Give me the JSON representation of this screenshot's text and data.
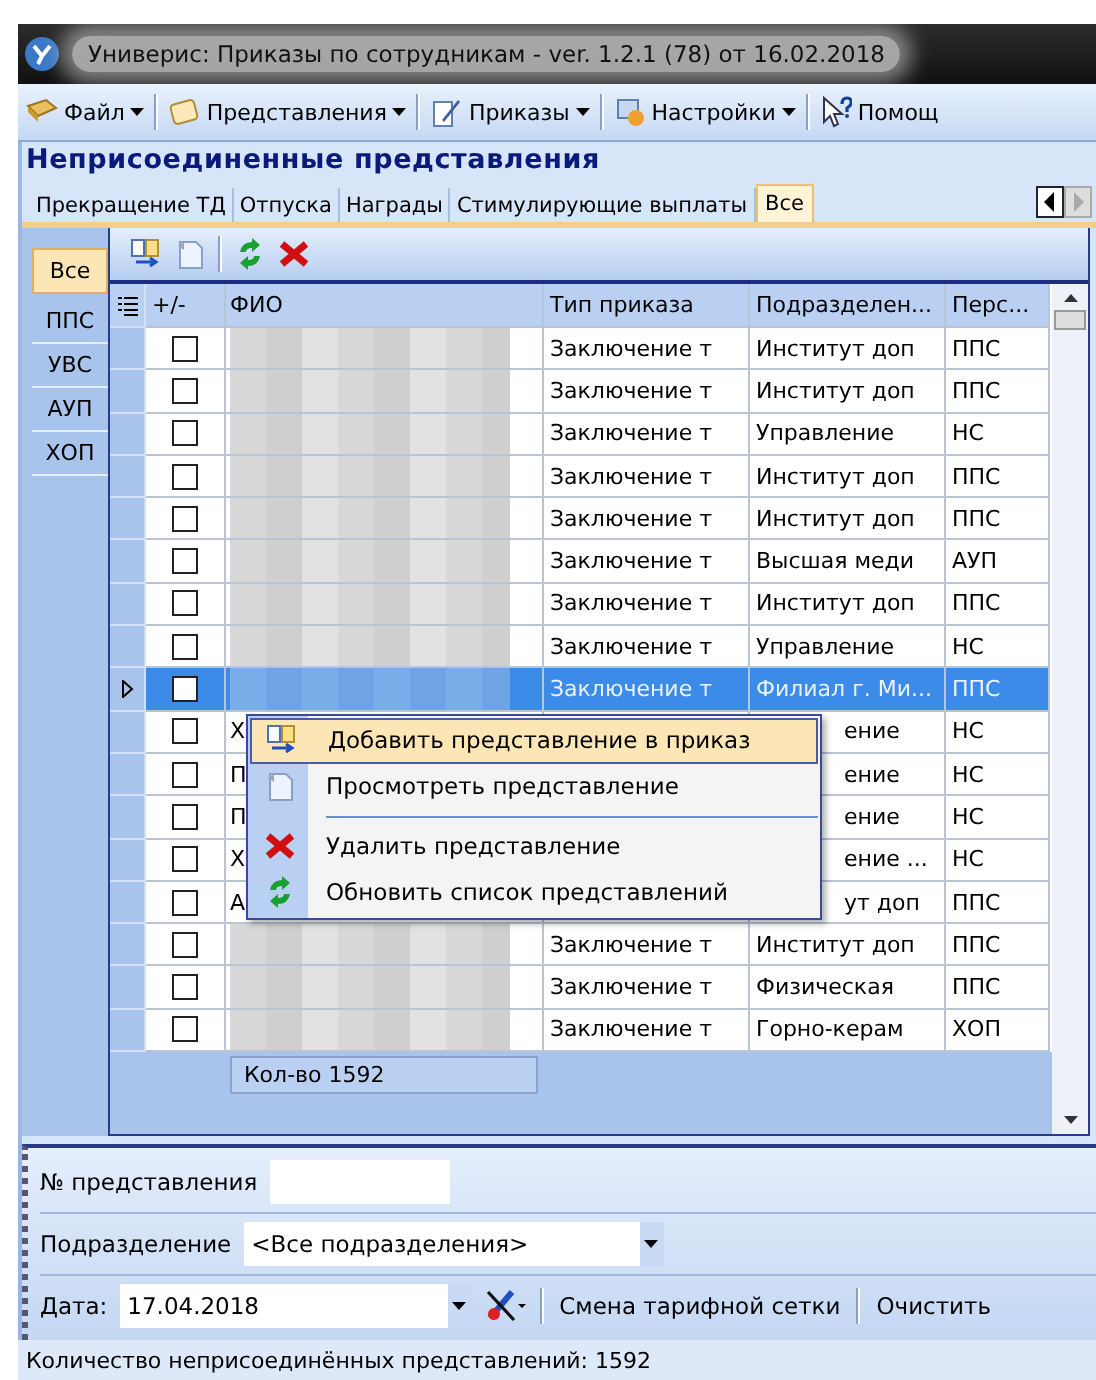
{
  "window": {
    "title": "Универис: Приказы по сотрудникам  -  ver. 1.2.1 (78) от 16.02.2018"
  },
  "menu": [
    {
      "label": "Файл",
      "dropdown": true
    },
    {
      "label": "Представления",
      "dropdown": true
    },
    {
      "label": "Приказы",
      "dropdown": true
    },
    {
      "label": "Настройки",
      "dropdown": true
    },
    {
      "label": "Помощ",
      "dropdown": false
    }
  ],
  "panel_title": "Неприсоединенные представления",
  "tabs": [
    {
      "label": "Прекращение ТД",
      "selected": false
    },
    {
      "label": "Отпуска",
      "selected": false
    },
    {
      "label": "Награды",
      "selected": false
    },
    {
      "label": "Стимулирующие выплаты",
      "selected": false
    },
    {
      "label": "Все",
      "selected": true
    }
  ],
  "side_tabs": [
    {
      "label": "Все",
      "selected": true
    },
    {
      "label": "ППС",
      "selected": false
    },
    {
      "label": "УВС",
      "selected": false
    },
    {
      "label": "АУП",
      "selected": false
    },
    {
      "label": "ХОП",
      "selected": false
    }
  ],
  "table": {
    "columns": [
      "+/-",
      "ФИО",
      "Тип приказа",
      "Подразделен...",
      "Перс..."
    ],
    "rows": [
      {
        "fio_hidden": true,
        "type": "Заключение т",
        "dept": "Институт доп",
        "staff": "ППС",
        "checked": false,
        "selected": false
      },
      {
        "fio_hidden": true,
        "type": "Заключение т",
        "dept": "Институт доп",
        "staff": "ППС",
        "checked": false,
        "selected": false
      },
      {
        "fio_hidden": true,
        "type": "Заключение т",
        "dept": "Управление",
        "staff": "НС",
        "checked": false,
        "selected": false
      },
      {
        "fio_hidden": true,
        "type": "Заключение т",
        "dept": "Институт доп",
        "staff": "ППС",
        "checked": false,
        "selected": false
      },
      {
        "fio_hidden": true,
        "type": "Заключение т",
        "dept": "Институт доп",
        "staff": "ППС",
        "checked": false,
        "selected": false
      },
      {
        "fio_hidden": true,
        "type": "Заключение т",
        "dept": "Высшая меди",
        "staff": "АУП",
        "checked": false,
        "selected": false
      },
      {
        "fio_hidden": true,
        "type": "Заключение т",
        "dept": "Институт доп",
        "staff": "ППС",
        "checked": false,
        "selected": false
      },
      {
        "fio_hidden": true,
        "type": "Заключение т",
        "dept": "Управление",
        "staff": "НС",
        "checked": false,
        "selected": false
      },
      {
        "fio_hidden": true,
        "type": "Заключение т",
        "dept": "Филиал г. Ми...",
        "staff": "ППС",
        "checked": false,
        "selected": true
      },
      {
        "fio_hidden": false,
        "fio": "Х",
        "dept": "ение",
        "staff": "НС",
        "checked": false,
        "selected": false
      },
      {
        "fio_hidden": false,
        "fio": "П",
        "dept": "ение",
        "staff": "НС",
        "checked": false,
        "selected": false
      },
      {
        "fio_hidden": false,
        "fio": "П",
        "dept": "ение",
        "staff": "НС",
        "checked": false,
        "selected": false
      },
      {
        "fio_hidden": false,
        "fio": "Х",
        "dept": "ение ...",
        "staff": "НС",
        "checked": false,
        "selected": false
      },
      {
        "fio_hidden": false,
        "fio": "А",
        "dept": "ут доп",
        "staff": "ППС",
        "checked": false,
        "selected": false
      },
      {
        "fio_hidden": true,
        "type": "Заключение т",
        "dept": "Институт доп",
        "staff": "ППС",
        "checked": false,
        "selected": false
      },
      {
        "fio_hidden": true,
        "type": "Заключение т",
        "dept": "Физическая",
        "staff": "ППС",
        "checked": false,
        "selected": false
      },
      {
        "fio_hidden": true,
        "type": "Заключение т",
        "dept": "Горно-керам",
        "staff": "ХОП",
        "checked": false,
        "selected": false
      }
    ],
    "footer": "Кол-во 1592"
  },
  "context_menu": [
    {
      "kind": "item",
      "label": "Добавить представление в приказ",
      "selected": true
    },
    {
      "kind": "item",
      "label": "Просмотреть представление",
      "selected": false
    },
    {
      "kind": "separator"
    },
    {
      "kind": "item",
      "label": "Удалить представление",
      "selected": false
    },
    {
      "kind": "item",
      "label": "Обновить список представлений",
      "selected": false
    }
  ],
  "filters": {
    "number_label": "№ представления",
    "dept_label": "Подразделение",
    "dept_value": "<Все подразделения>",
    "date_label": "Дата:",
    "date_value": "17.04.2018",
    "buttons": [
      "Смена тарифной сетки",
      "Очистить"
    ]
  },
  "status_bar": "Количество неприсоединённых представлений: 1592"
}
